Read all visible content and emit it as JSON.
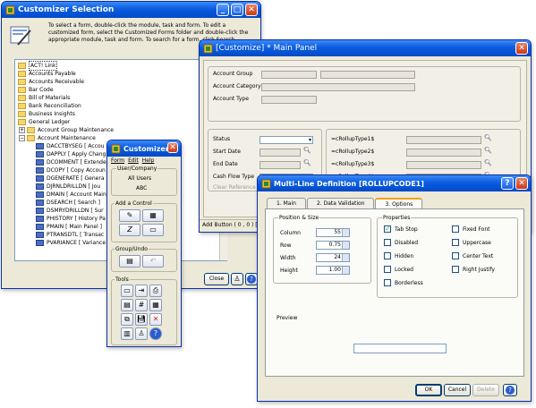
{
  "selection": {
    "title": "Customizer Selection",
    "instructions": "To select a form, double-click the module, task and form. To edit a customized form, select the Customized Forms folder and double-click the appropriate module, task and form. To search for a form, click Search.",
    "tree": [
      {
        "kind": "folder",
        "label": "ACT! Link",
        "selected": true
      },
      {
        "kind": "folder",
        "label": "Accounts Payable"
      },
      {
        "kind": "folder",
        "label": "Accounts Receivable"
      },
      {
        "kind": "folder",
        "label": "Bar Code"
      },
      {
        "kind": "folder",
        "label": "Bill of Materials"
      },
      {
        "kind": "folder",
        "label": "Bank Reconciliation"
      },
      {
        "kind": "folder",
        "label": "Business Insights"
      },
      {
        "kind": "folder",
        "label": "General Ledger"
      },
      {
        "kind": "folder",
        "label": "Account Group Maintenance",
        "indent": 1,
        "expander": "+"
      },
      {
        "kind": "folder",
        "label": "Account Maintenance",
        "indent": 1,
        "expander": "−"
      },
      {
        "kind": "form",
        "label": "DACCTBYSEG  [ Accou",
        "indent": 2
      },
      {
        "kind": "form",
        "label": "DAPPLY  [ Apply Chang",
        "indent": 2
      },
      {
        "kind": "form",
        "label": "DCOMMENT  [ Extende",
        "indent": 2
      },
      {
        "kind": "form",
        "label": "DCOPY  [ Copy Accoun",
        "indent": 2
      },
      {
        "kind": "form",
        "label": "DGENERATE  [ Genera",
        "indent": 2
      },
      {
        "kind": "form",
        "label": "DJRNLDRILLDN  [ Jou",
        "indent": 2
      },
      {
        "kind": "form",
        "label": "DMAIN  [ Account Main",
        "indent": 2
      },
      {
        "kind": "form",
        "label": "DSEARCH  [ Search ]",
        "indent": 2
      },
      {
        "kind": "form",
        "label": "DSMRYDRILLDN  [ Sur",
        "indent": 2
      },
      {
        "kind": "form",
        "label": "PHISTORY  [ History Pa",
        "indent": 2
      },
      {
        "kind": "form",
        "label": "PMAIN  [ Main Panel ]",
        "indent": 2
      },
      {
        "kind": "form",
        "label": "PTRANSDTL  [ Transac",
        "indent": 2
      },
      {
        "kind": "form",
        "label": "PVARIANCE  [ Variance",
        "indent": 2
      }
    ],
    "close_label": "Close"
  },
  "main_panel": {
    "title": "[Customize] * Main Panel",
    "fields": {
      "account_group": "Account Group",
      "account_category": "Account Category",
      "account_type": "Account Type",
      "status": "Status",
      "start_date": "Start Date",
      "end_date": "End Date",
      "cash_flow_type": "Cash Flow Type",
      "clear_reference": "Clear Reference"
    },
    "rollups": [
      "=cRollupType1$",
      "=cRollupType2$",
      "=cRollupType3$",
      "=cRollupType4$"
    ],
    "statusbar": "Add Button  ( 0 , 0 )  [ 1"
  },
  "toolbox": {
    "title": "Customizer",
    "menu": [
      "Form",
      "Edit",
      "Help"
    ],
    "group_users": "User/Company",
    "all_users": "All Users",
    "company": "ABC",
    "group_add": "Add a Control",
    "group_undo": "Group/Undo",
    "group_tools": "Tools"
  },
  "multiline": {
    "title": "Multi-Line Definition  [ROLLUPCODE1]",
    "tabs": [
      "1. Main",
      "2. Data Validation",
      "3. Options"
    ],
    "active_tab": 2,
    "pos_group": "Position & Size",
    "pos": [
      {
        "label": "Column",
        "value": "55"
      },
      {
        "label": "Row",
        "value": "0.75"
      },
      {
        "label": "Width",
        "value": "24"
      },
      {
        "label": "Height",
        "value": "1.00"
      }
    ],
    "props_group": "Properties",
    "props_left": [
      {
        "label": "Tab Stop",
        "checked": true
      },
      {
        "label": "Disabled",
        "checked": false
      },
      {
        "label": "Hidden",
        "checked": false
      },
      {
        "label": "Locked",
        "checked": false
      },
      {
        "label": "Borderless",
        "checked": false
      }
    ],
    "props_right": [
      {
        "label": "Fixed Font",
        "checked": false
      },
      {
        "label": "Uppercase",
        "checked": false
      },
      {
        "label": "Center Text",
        "checked": false
      },
      {
        "label": "Right Justify",
        "checked": false
      }
    ],
    "preview_label": "Preview",
    "ok_label": "OK",
    "cancel_label": "Cancel",
    "delete_label": "Delete"
  }
}
